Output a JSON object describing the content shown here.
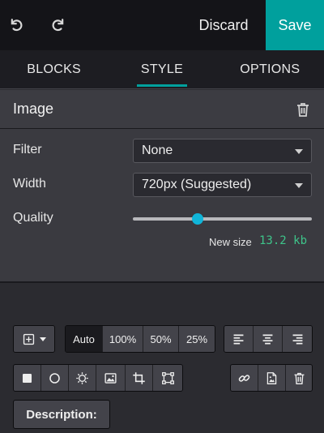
{
  "topbar": {
    "discard_label": "Discard",
    "save_label": "Save",
    "undo_icon": "undo-icon",
    "redo_icon": "redo-icon"
  },
  "tabs": [
    {
      "label": "BLOCKS",
      "active": false
    },
    {
      "label": "STYLE",
      "active": true
    },
    {
      "label": "OPTIONS",
      "active": false
    }
  ],
  "section": {
    "title": "Image",
    "delete_icon": "trash-icon"
  },
  "options": {
    "filter_label": "Filter",
    "filter_value": "None",
    "width_label": "Width",
    "width_value": "720px (Suggested)",
    "quality_label": "Quality",
    "quality_fraction": 0.36,
    "newsize_label": "New size",
    "newsize_value": "13.2 kb"
  },
  "toolbar": {
    "size_auto": "Auto",
    "size_100": "100%",
    "size_50": "50%",
    "size_25": "25%",
    "description_label": "Description:"
  },
  "colors": {
    "accent": "#00a09d",
    "slider_thumb": "#10b5d9",
    "newsize": "#3ec48a"
  }
}
